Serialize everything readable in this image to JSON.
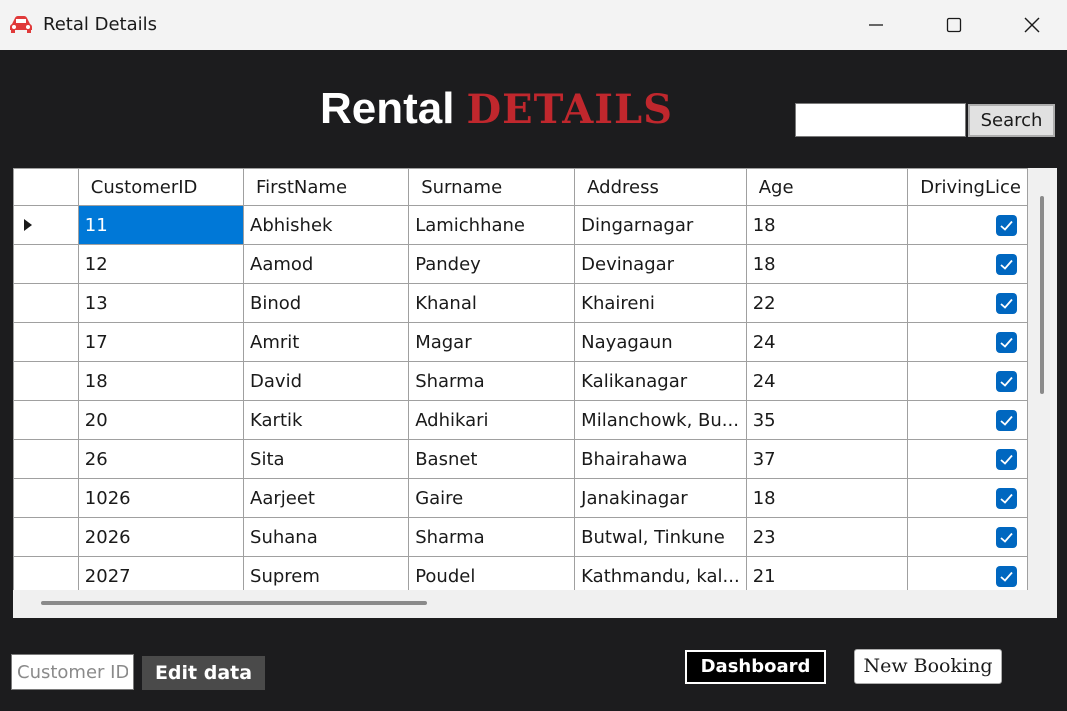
{
  "window": {
    "title": "Retal Details",
    "icon": "car-icon",
    "controls": [
      "minimize-icon",
      "maximize-icon",
      "close-icon"
    ]
  },
  "heading": {
    "part1": "Rental",
    "part2": "DETAILS"
  },
  "search": {
    "value": "",
    "button_label": "Search"
  },
  "table": {
    "columns": [
      "CustomerID",
      "FirstName",
      "Surname",
      "Address",
      "Age",
      "DrivingLice"
    ],
    "rows": [
      {
        "id": "11",
        "first": "Abhishek",
        "surname": "Lamichhane",
        "address": "Dingarnagar",
        "age": "18",
        "license": true
      },
      {
        "id": "12",
        "first": "Aamod",
        "surname": "Pandey",
        "address": "Devinagar",
        "age": "18",
        "license": true
      },
      {
        "id": "13",
        "first": "Binod",
        "surname": "Khanal",
        "address": "Khaireni",
        "age": "22",
        "license": true
      },
      {
        "id": "17",
        "first": "Amrit",
        "surname": "Magar",
        "address": "Nayagaun",
        "age": "24",
        "license": true
      },
      {
        "id": "18",
        "first": "David",
        "surname": "Sharma",
        "address": "Kalikanagar",
        "age": "24",
        "license": true
      },
      {
        "id": "20",
        "first": "Kartik",
        "surname": "Adhikari",
        "address": "Milanchowk, Bu...",
        "age": "35",
        "license": true
      },
      {
        "id": "26",
        "first": "Sita",
        "surname": "Basnet",
        "address": "Bhairahawa",
        "age": "37",
        "license": true
      },
      {
        "id": "1026",
        "first": "Aarjeet",
        "surname": "Gaire",
        "address": "Janakinagar",
        "age": "18",
        "license": true
      },
      {
        "id": "2026",
        "first": "Suhana",
        "surname": "Sharma",
        "address": "Butwal, Tinkune",
        "age": "23",
        "license": true
      },
      {
        "id": "2027",
        "first": "Suprem",
        "surname": "Poudel",
        "address": "Kathmandu, kal...",
        "age": "21",
        "license": true
      }
    ],
    "selected_row": 0
  },
  "bottom": {
    "customer_id_placeholder": "Customer ID",
    "edit_label": "Edit data",
    "dashboard_label": "Dashboard",
    "new_booking_label": "New Booking"
  },
  "colors": {
    "background": "#1c1c1e",
    "accent_red": "#c0272d",
    "selection": "#0078d7",
    "checkbox": "#0067c0"
  }
}
